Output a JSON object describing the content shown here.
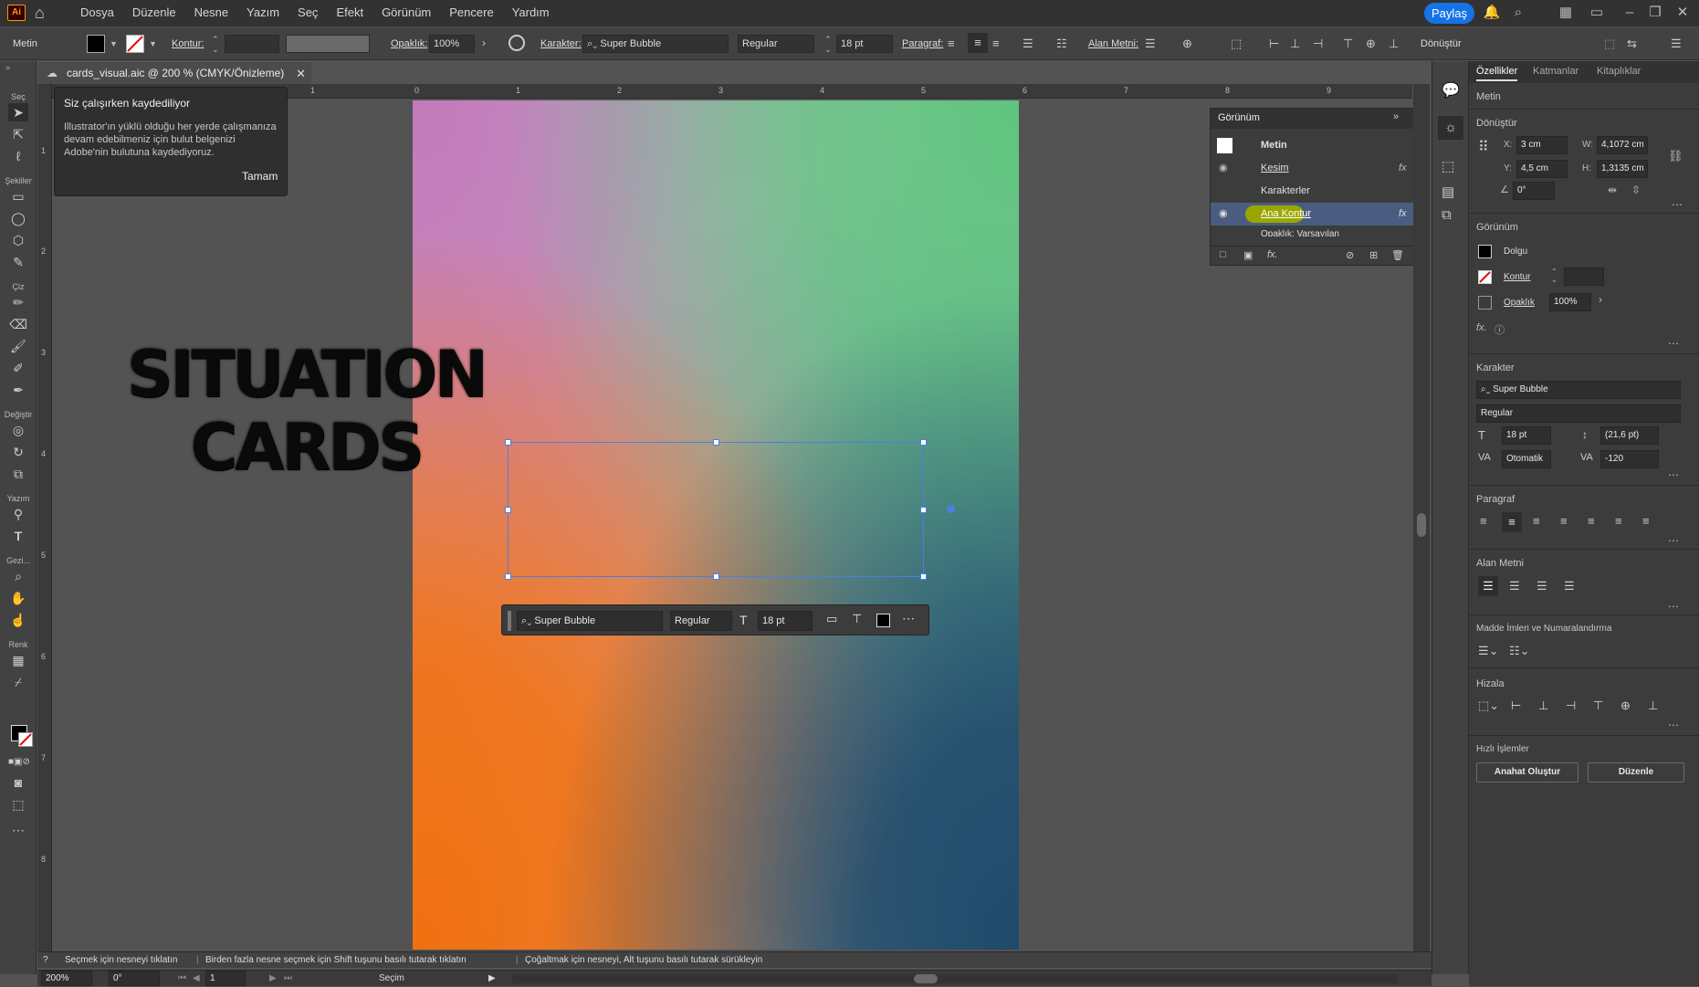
{
  "menubar": {
    "logo": "Ai",
    "items": [
      "Dosya",
      "Düzenle",
      "Nesne",
      "Yazım",
      "Seç",
      "Efekt",
      "Görünüm",
      "Pencere",
      "Yardım"
    ],
    "share_label": "Paylaş"
  },
  "controlbar": {
    "object_type": "Metin",
    "stroke_label": "Kontur:",
    "opacity_label": "Opaklık:",
    "opacity_value": "100%",
    "character_label": "Karakter:",
    "font_name": "Super Bubble",
    "font_style": "Regular",
    "font_size": "18 pt",
    "paragraph_label": "Paragraf:",
    "area_text_label": "Alan Metni:",
    "transform_label": "Dönüştür"
  },
  "doc_tab": {
    "title": "cards_visual.aic @ 200 % (CMYK/Önizleme)"
  },
  "tooltip": {
    "title": "Siz çalışırken kaydediliyor",
    "body": "Illustrator'ın yüklü olduğu her yerde çalışmanıza devam edebilmeniz için bulut belgenizi Adobe'nin bulutuna kaydediyoruz.",
    "ok_label": "Tamam"
  },
  "toolbar_labels": {
    "select": "Seç",
    "shapes": "Şekiller",
    "draw": "Çiz",
    "modify": "Değiştir",
    "type": "Yazım",
    "navigate": "Gezi...",
    "color": "Renk"
  },
  "ruler": {
    "horizontal": [
      "1",
      "0",
      "1",
      "2",
      "3",
      "4",
      "5",
      "6",
      "7",
      "8",
      "9"
    ],
    "vertical": [
      "1",
      "2",
      "3",
      "4",
      "5",
      "6",
      "7",
      "8"
    ]
  },
  "artboard": {
    "text_line1": "SITUATION",
    "text_line2": "CARDS"
  },
  "context_toolbar": {
    "font_name": "Super Bubble",
    "font_style": "Regular",
    "font_size": "18 pt"
  },
  "appearance_panel": {
    "title": "Görünüm",
    "rows": [
      {
        "label": "Metin"
      },
      {
        "label": "Kesim"
      },
      {
        "label": "Karakterler"
      },
      {
        "label": "Ana Kontur"
      },
      {
        "label": "Opaklık: Varsayılan"
      }
    ]
  },
  "properties": {
    "tabs": [
      "Özellikler",
      "Katmanlar",
      "Kitaplıklar"
    ],
    "object_type": "Metin",
    "transform": {
      "title": "Dönüştür",
      "x_label": "X:",
      "x": "3 cm",
      "y_label": "Y:",
      "y": "4,5 cm",
      "w_label": "W:",
      "w": "4,1072 cm",
      "h_label": "H:",
      "h": "1,3135 cm",
      "angle": "0°"
    },
    "appearance": {
      "title": "Görünüm",
      "fill_label": "Dolgu",
      "stroke_label": "Kontur",
      "opacity_label": "Opaklık",
      "opacity_value": "100%",
      "fx_label": "fx."
    },
    "character": {
      "title": "Karakter",
      "font_name": "Super Bubble",
      "font_style": "Regular",
      "font_size": "18 pt",
      "leading": "(21,6 pt)",
      "kerning": "Otomatik",
      "tracking": "-120"
    },
    "paragraph_title": "Paragraf",
    "area_text_title": "Alan Metni",
    "bullets_title": "Madde İmleri ve Numaralandırma",
    "align_title": "Hizala",
    "quick_actions": {
      "title": "Hızlı İşlemler",
      "outline_label": "Anahat Oluştur",
      "edit_label": "Düzenle"
    }
  },
  "statusbar": {
    "hint_1": "Seçmek için nesneyi tıklatın",
    "hint_2": "Birden fazla nesne seçmek için Shift tuşunu basılı tutarak tıklatın",
    "hint_3": "Çoğaltmak için nesneyi, Alt tuşunu basılı tutarak sürükleyin",
    "zoom": "200%",
    "rotation": "0°",
    "artboard_num": "1",
    "tool_name": "Seçim"
  },
  "colors": {
    "accent": "#1473e6",
    "selection": "#4a7fe0",
    "highlight": "#9aa600"
  }
}
